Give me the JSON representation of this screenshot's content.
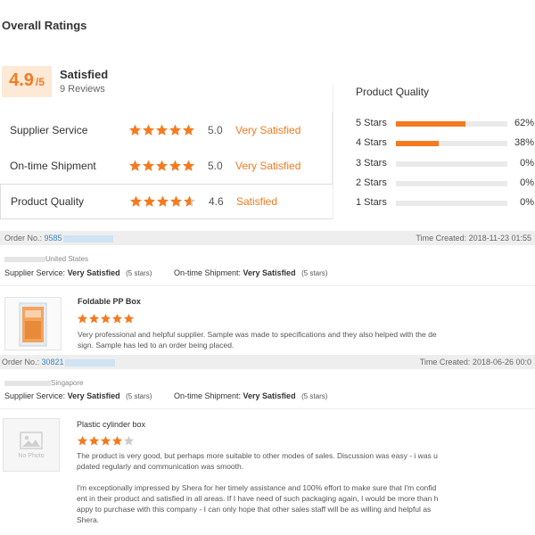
{
  "header": {
    "title": "Overall Ratings"
  },
  "summary": {
    "score": "4.9",
    "scale": "/5",
    "label": "Satisfied",
    "reviews": "9 Reviews"
  },
  "ratings": [
    {
      "label": "Supplier Service",
      "score": "5.0",
      "text": "Very Satisfied",
      "stars": 5
    },
    {
      "label": "On-time Shipment",
      "score": "5.0",
      "text": "Very Satisfied",
      "stars": 5
    },
    {
      "label": "Product Quality",
      "score": "4.6",
      "text": "Satisfied",
      "stars": 4.6
    }
  ],
  "product_quality_panel": {
    "title": "Product Quality",
    "rows": [
      {
        "label": "5 Stars",
        "pct": "62%",
        "fraction": 0.62
      },
      {
        "label": "4 Stars",
        "pct": "38%",
        "fraction": 0.38
      },
      {
        "label": "3 Stars",
        "pct": "0%",
        "fraction": 0
      },
      {
        "label": "2 Stars",
        "pct": "0%",
        "fraction": 0
      },
      {
        "label": "1 Stars",
        "pct": "0%",
        "fraction": 0
      }
    ]
  },
  "orders": [
    {
      "order_label": "Order No.:",
      "order_no": "9585",
      "time_created": "Time Created:  2018-11-23 01:55",
      "buyer_country": "United States",
      "supplier_service_label": "Supplier Service:",
      "supplier_service_value": "Very Satisfied",
      "supplier_service_stars": "(5 stars)",
      "shipment_label": "On-time Shipment:",
      "shipment_value": "Very Satisfied",
      "shipment_stars": "(5 stars)",
      "product_name": "Foldable PP Box",
      "review_stars": 5,
      "review_lines": [
        "Very professional and helpful supplier. Sample was made to specifications and they also helped with the de",
        "sign. Sample has led to an order being placed."
      ]
    },
    {
      "order_label": "Order No.:",
      "order_no": "30821",
      "time_created": "Time Created:  2018-06-26 00:0",
      "buyer_country": "Singapore",
      "supplier_service_label": "Supplier Service:",
      "supplier_service_value": "Very Satisfied",
      "supplier_service_stars": "(5 stars)",
      "shipment_label": "On-time Shipment:",
      "shipment_value": "Very Satisfied",
      "shipment_stars": "(5 stars)",
      "product_name": "Plastic cylinder box",
      "review_stars": 4,
      "no_photo": "No Photo",
      "review_lines": [
        "The product is very good, but perhaps more suitable to other modes of sales. Discussion was easy - i was u",
        "pdated regularly and communication was smooth.",
        "",
        "I'm exceptionally impressed by Shera for her timely assistance and 100% effort to make sure that I'm confid",
        "ent in their product and satisfied in all areas. If I have need of such packaging again, I would be more than h",
        "appy to purchase with this company - I can only hope that other sales staff will be as willing and helpful as",
        "Shera."
      ]
    }
  ],
  "colors": {
    "accent": "#f47a20",
    "star_empty": "#cccccc",
    "link": "#3a84c5"
  }
}
